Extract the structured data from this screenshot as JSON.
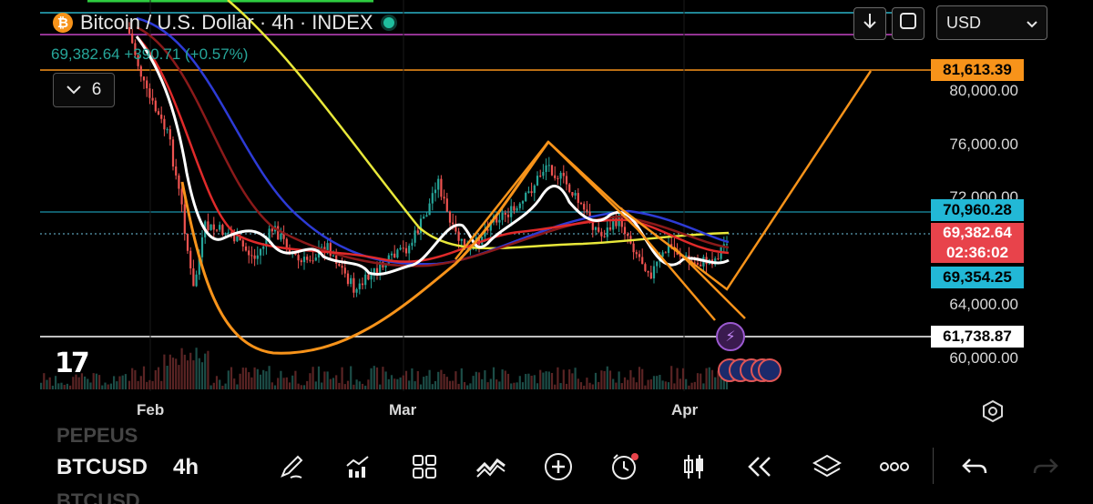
{
  "header": {
    "symbol_icon": "bitcoin-icon",
    "title": "Bitcoin / U.S. Dollar · 4h · INDEX",
    "status_dot_color": "#1fbf9f",
    "ohlc_line": "69,382.64 +390.71 (+0.57%)",
    "indicators_count": "6"
  },
  "top_controls": {
    "download_icon": "arrow-down-icon",
    "fullscreen_icon": "fullscreen-icon",
    "currency": "USD"
  },
  "price_axis": {
    "labels": [
      "80,000.00",
      "76,000.00",
      "72,000.00",
      "64,000.00",
      "60,000.00"
    ]
  },
  "price_tags": {
    "alert_level": "81,613.39",
    "line_level": "70,960.28",
    "last_price": "69,382.64",
    "countdown": "02:36:02",
    "lower_line": "69,354.25",
    "support": "61,738.87"
  },
  "time_axis": {
    "labels": [
      "Feb",
      "Mar",
      "Apr"
    ]
  },
  "bottom_bar": {
    "prev_symbol": "PEPEUS",
    "symbol": "BTCUSD",
    "timeframe": "4h",
    "next_symbol": "BTCUSD",
    "tools": [
      "pen-icon",
      "indicators-chart-icon",
      "grid-layout-icon",
      "compare-icon",
      "add-icon",
      "alert-clock-icon",
      "candles-icon",
      "replay-icon",
      "layers-icon",
      "more-icon",
      "undo-icon"
    ]
  },
  "colors": {
    "up": "#26a69a",
    "down": "#ef5350",
    "orange": "#f7931a",
    "cyan_tag": "#22b8d6",
    "red_tag": "#e8434b"
  }
}
